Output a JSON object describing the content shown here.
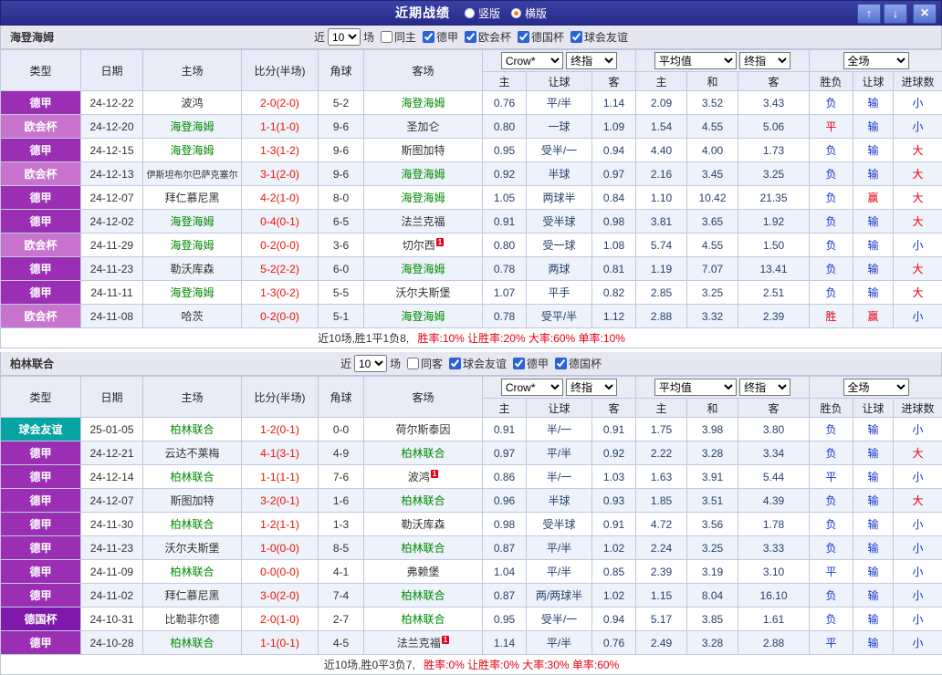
{
  "colors": {
    "league": {
      "德甲": "#9b2fb4",
      "欧会杯": "#c873cd",
      "德国杯": "#7e18ab",
      "球会友谊": "#06a3a3"
    },
    "team_green": "#008a00",
    "score_red": "#ee1100",
    "result_red": "#e60012",
    "result_blue": "#1536c8",
    "odds_text": "#27416b",
    "titlebar_bg": "#2e3192",
    "radio_selected_dot": "#ff8800"
  },
  "titlebar": {
    "title": "近期战绩",
    "radios": [
      {
        "label": "竖版",
        "selected": false
      },
      {
        "label": "横版",
        "selected": true
      }
    ],
    "up_icon": "↑",
    "down_icon": "↓",
    "close_icon": "×"
  },
  "sections": [
    {
      "team": "海登海姆",
      "filter": {
        "near_label": "近",
        "count": "10",
        "matches_label": "场",
        "same_label": "同主",
        "same_checked": false,
        "leagues": [
          {
            "label": "德甲",
            "checked": true
          },
          {
            "label": "欧会杯",
            "checked": true
          },
          {
            "label": "德国杯",
            "checked": true
          },
          {
            "label": "球会友谊",
            "checked": true
          }
        ]
      },
      "header": {
        "type": "类型",
        "date": "日期",
        "home": "主场",
        "score": "比分(半场)",
        "corner": "角球",
        "away": "客场",
        "bookmaker": "Crow*",
        "final1": "终指",
        "average": "平均值",
        "final2": "终指",
        "scope": "全场",
        "sub": [
          "主",
          "让球",
          "客",
          "主",
          "和",
          "客",
          "胜负",
          "让球",
          "进球数"
        ]
      },
      "rows": [
        {
          "league": "德甲",
          "date": "24-12-22",
          "home": "波鸿",
          "home_team": false,
          "score": "2-0(2-0)",
          "corners": "5-2",
          "away": "海登海姆",
          "away_team": true,
          "o1": "0.76",
          "handicap": "平/半",
          "o2": "1.14",
          "a1": "2.09",
          "a2": "3.52",
          "a3": "3.43",
          "res": "负",
          "res_c": "blue",
          "hres": "输",
          "hres_c": "blue",
          "goals": "小",
          "goals_c": "blue"
        },
        {
          "league": "欧会杯",
          "date": "24-12-20",
          "home": "海登海姆",
          "home_team": true,
          "score": "1-1(1-0)",
          "corners": "9-6",
          "away": "圣加仑",
          "away_team": false,
          "o1": "0.80",
          "handicap": "一球",
          "o2": "1.09",
          "a1": "1.54",
          "a2": "4.55",
          "a3": "5.06",
          "res": "平",
          "res_c": "red",
          "hres": "输",
          "hres_c": "blue",
          "goals": "小",
          "goals_c": "blue"
        },
        {
          "league": "德甲",
          "date": "24-12-15",
          "home": "海登海姆",
          "home_team": true,
          "score": "1-3(1-2)",
          "corners": "9-6",
          "away": "斯图加特",
          "away_team": false,
          "o1": "0.95",
          "handicap": "受半/一",
          "o2": "0.94",
          "a1": "4.40",
          "a2": "4.00",
          "a3": "1.73",
          "res": "负",
          "res_c": "blue",
          "hres": "输",
          "hres_c": "blue",
          "goals": "大",
          "goals_c": "red"
        },
        {
          "league": "欧会杯",
          "date": "24-12-13",
          "home": "伊斯坦布尔巴萨克塞尔",
          "home_team": false,
          "score": "3-1(2-0)",
          "corners": "9-6",
          "away": "海登海姆",
          "away_team": true,
          "o1": "0.92",
          "handicap": "半球",
          "o2": "0.97",
          "a1": "2.16",
          "a2": "3.45",
          "a3": "3.25",
          "res": "负",
          "res_c": "blue",
          "hres": "输",
          "hres_c": "blue",
          "goals": "大",
          "goals_c": "red"
        },
        {
          "league": "德甲",
          "date": "24-12-07",
          "home": "拜仁慕尼黑",
          "home_team": false,
          "score": "4-2(1-0)",
          "corners": "8-0",
          "away": "海登海姆",
          "away_team": true,
          "o1": "1.05",
          "handicap": "两球半",
          "o2": "0.84",
          "a1": "1.10",
          "a2": "10.42",
          "a3": "21.35",
          "res": "负",
          "res_c": "blue",
          "hres": "赢",
          "hres_c": "red",
          "goals": "大",
          "goals_c": "red"
        },
        {
          "league": "德甲",
          "date": "24-12-02",
          "home": "海登海姆",
          "home_team": true,
          "score": "0-4(0-1)",
          "corners": "6-5",
          "away": "法兰克福",
          "away_team": false,
          "o1": "0.91",
          "handicap": "受半球",
          "o2": "0.98",
          "a1": "3.81",
          "a2": "3.65",
          "a3": "1.92",
          "res": "负",
          "res_c": "blue",
          "hres": "输",
          "hres_c": "blue",
          "goals": "大",
          "goals_c": "red"
        },
        {
          "league": "欧会杯",
          "date": "24-11-29",
          "home": "海登海姆",
          "home_team": true,
          "score": "0-2(0-0)",
          "corners": "3-6",
          "away": "切尔西",
          "away_team": false,
          "away_sup": "1",
          "o1": "0.80",
          "handicap": "受一球",
          "o2": "1.08",
          "a1": "5.74",
          "a2": "4.55",
          "a3": "1.50",
          "res": "负",
          "res_c": "blue",
          "hres": "输",
          "hres_c": "blue",
          "goals": "小",
          "goals_c": "blue"
        },
        {
          "league": "德甲",
          "date": "24-11-23",
          "home": "勒沃库森",
          "home_team": false,
          "score": "5-2(2-2)",
          "corners": "6-0",
          "away": "海登海姆",
          "away_team": true,
          "o1": "0.78",
          "handicap": "两球",
          "o2": "0.81",
          "a1": "1.19",
          "a2": "7.07",
          "a3": "13.41",
          "res": "负",
          "res_c": "blue",
          "hres": "输",
          "hres_c": "blue",
          "goals": "大",
          "goals_c": "red"
        },
        {
          "league": "德甲",
          "date": "24-11-11",
          "home": "海登海姆",
          "home_team": true,
          "score": "1-3(0-2)",
          "corners": "5-5",
          "away": "沃尔夫斯堡",
          "away_team": false,
          "o1": "1.07",
          "handicap": "平手",
          "o2": "0.82",
          "a1": "2.85",
          "a2": "3.25",
          "a3": "2.51",
          "res": "负",
          "res_c": "blue",
          "hres": "输",
          "hres_c": "blue",
          "goals": "大",
          "goals_c": "red"
        },
        {
          "league": "欧会杯",
          "date": "24-11-08",
          "home": "哈茨",
          "home_team": false,
          "score": "0-2(0-0)",
          "corners": "5-1",
          "away": "海登海姆",
          "away_team": true,
          "o1": "0.78",
          "handicap": "受平/半",
          "o2": "1.12",
          "a1": "2.88",
          "a2": "3.32",
          "a3": "2.39",
          "res": "胜",
          "res_c": "red",
          "hres": "赢",
          "hres_c": "red",
          "goals": "小",
          "goals_c": "blue"
        }
      ],
      "footer": {
        "summary": "近10场,胜1平1负8,",
        "rates": "胜率:10% 让胜率:20% 大率:60% 单率:10%"
      }
    },
    {
      "team": "柏林联合",
      "filter": {
        "near_label": "近",
        "count": "10",
        "matches_label": "场",
        "same_label": "同客",
        "same_checked": false,
        "leagues": [
          {
            "label": "球会友谊",
            "checked": true
          },
          {
            "label": "德甲",
            "checked": true
          },
          {
            "label": "德国杯",
            "checked": true
          }
        ]
      },
      "header": {
        "type": "类型",
        "date": "日期",
        "home": "主场",
        "score": "比分(半场)",
        "corner": "角球",
        "away": "客场",
        "bookmaker": "Crow*",
        "final1": "终指",
        "average": "平均值",
        "final2": "终指",
        "scope": "全场",
        "sub": [
          "主",
          "让球",
          "客",
          "主",
          "和",
          "客",
          "胜负",
          "让球",
          "进球数"
        ]
      },
      "rows": [
        {
          "league": "球会友谊",
          "date": "25-01-05",
          "home": "柏林联合",
          "home_team": true,
          "score": "1-2(0-1)",
          "corners": "0-0",
          "away": "荷尔斯泰因",
          "away_team": false,
          "o1": "0.91",
          "handicap": "半/一",
          "o2": "0.91",
          "a1": "1.75",
          "a2": "3.98",
          "a3": "3.80",
          "res": "负",
          "res_c": "blue",
          "hres": "输",
          "hres_c": "blue",
          "goals": "小",
          "goals_c": "blue"
        },
        {
          "league": "德甲",
          "date": "24-12-21",
          "home": "云达不莱梅",
          "home_team": false,
          "score": "4-1(3-1)",
          "corners": "4-9",
          "away": "柏林联合",
          "away_team": true,
          "o1": "0.97",
          "handicap": "平/半",
          "o2": "0.92",
          "a1": "2.22",
          "a2": "3.28",
          "a3": "3.34",
          "res": "负",
          "res_c": "blue",
          "hres": "输",
          "hres_c": "blue",
          "goals": "大",
          "goals_c": "red"
        },
        {
          "league": "德甲",
          "date": "24-12-14",
          "home": "柏林联合",
          "home_team": true,
          "score": "1-1(1-1)",
          "corners": "7-6",
          "away": "波鸿",
          "away_team": false,
          "away_sup": "1",
          "o1": "0.86",
          "handicap": "半/一",
          "o2": "1.03",
          "a1": "1.63",
          "a2": "3.91",
          "a3": "5.44",
          "res": "平",
          "res_c": "blue",
          "hres": "输",
          "hres_c": "blue",
          "goals": "小",
          "goals_c": "blue"
        },
        {
          "league": "德甲",
          "date": "24-12-07",
          "home": "斯图加特",
          "home_team": false,
          "score": "3-2(0-1)",
          "corners": "1-6",
          "away": "柏林联合",
          "away_team": true,
          "o1": "0.96",
          "handicap": "半球",
          "o2": "0.93",
          "a1": "1.85",
          "a2": "3.51",
          "a3": "4.39",
          "res": "负",
          "res_c": "blue",
          "hres": "输",
          "hres_c": "blue",
          "goals": "大",
          "goals_c": "red"
        },
        {
          "league": "德甲",
          "date": "24-11-30",
          "home": "柏林联合",
          "home_team": true,
          "score": "1-2(1-1)",
          "corners": "1-3",
          "away": "勒沃库森",
          "away_team": false,
          "o1": "0.98",
          "handicap": "受半球",
          "o2": "0.91",
          "a1": "4.72",
          "a2": "3.56",
          "a3": "1.78",
          "res": "负",
          "res_c": "blue",
          "hres": "输",
          "hres_c": "blue",
          "goals": "小",
          "goals_c": "blue"
        },
        {
          "league": "德甲",
          "date": "24-11-23",
          "home": "沃尔夫斯堡",
          "home_team": false,
          "score": "1-0(0-0)",
          "corners": "8-5",
          "away": "柏林联合",
          "away_team": true,
          "o1": "0.87",
          "handicap": "平/半",
          "o2": "1.02",
          "a1": "2.24",
          "a2": "3.25",
          "a3": "3.33",
          "res": "负",
          "res_c": "blue",
          "hres": "输",
          "hres_c": "blue",
          "goals": "小",
          "goals_c": "blue"
        },
        {
          "league": "德甲",
          "date": "24-11-09",
          "home": "柏林联合",
          "home_team": true,
          "score": "0-0(0-0)",
          "corners": "4-1",
          "away": "弗赖堡",
          "away_team": false,
          "o1": "1.04",
          "handicap": "平/半",
          "o2": "0.85",
          "a1": "2.39",
          "a2": "3.19",
          "a3": "3.10",
          "res": "平",
          "res_c": "blue",
          "hres": "输",
          "hres_c": "blue",
          "goals": "小",
          "goals_c": "blue"
        },
        {
          "league": "德甲",
          "date": "24-11-02",
          "home": "拜仁慕尼黑",
          "home_team": false,
          "score": "3-0(2-0)",
          "corners": "7-4",
          "away": "柏林联合",
          "away_team": true,
          "o1": "0.87",
          "handicap": "两/两球半",
          "o2": "1.02",
          "a1": "1.15",
          "a2": "8.04",
          "a3": "16.10",
          "res": "负",
          "res_c": "blue",
          "hres": "输",
          "hres_c": "blue",
          "goals": "小",
          "goals_c": "blue"
        },
        {
          "league": "德国杯",
          "date": "24-10-31",
          "home": "比勒菲尔德",
          "home_team": false,
          "score": "2-0(1-0)",
          "corners": "2-7",
          "away": "柏林联合",
          "away_team": true,
          "o1": "0.95",
          "handicap": "受半/一",
          "o2": "0.94",
          "a1": "5.17",
          "a2": "3.85",
          "a3": "1.61",
          "res": "负",
          "res_c": "blue",
          "hres": "输",
          "hres_c": "blue",
          "goals": "小",
          "goals_c": "blue"
        },
        {
          "league": "德甲",
          "date": "24-10-28",
          "home": "柏林联合",
          "home_team": true,
          "score": "1-1(0-1)",
          "corners": "4-5",
          "away": "法兰克福",
          "away_team": false,
          "away_sup": "1",
          "o1": "1.14",
          "handicap": "平/半",
          "o2": "0.76",
          "a1": "2.49",
          "a2": "3.28",
          "a3": "2.88",
          "res": "平",
          "res_c": "blue",
          "hres": "输",
          "hres_c": "blue",
          "goals": "小",
          "goals_c": "blue"
        }
      ],
      "footer": {
        "summary": "近10场,胜0平3负7,",
        "rates": "胜率:0% 让胜率:0% 大率:30% 单率:60%"
      }
    }
  ]
}
